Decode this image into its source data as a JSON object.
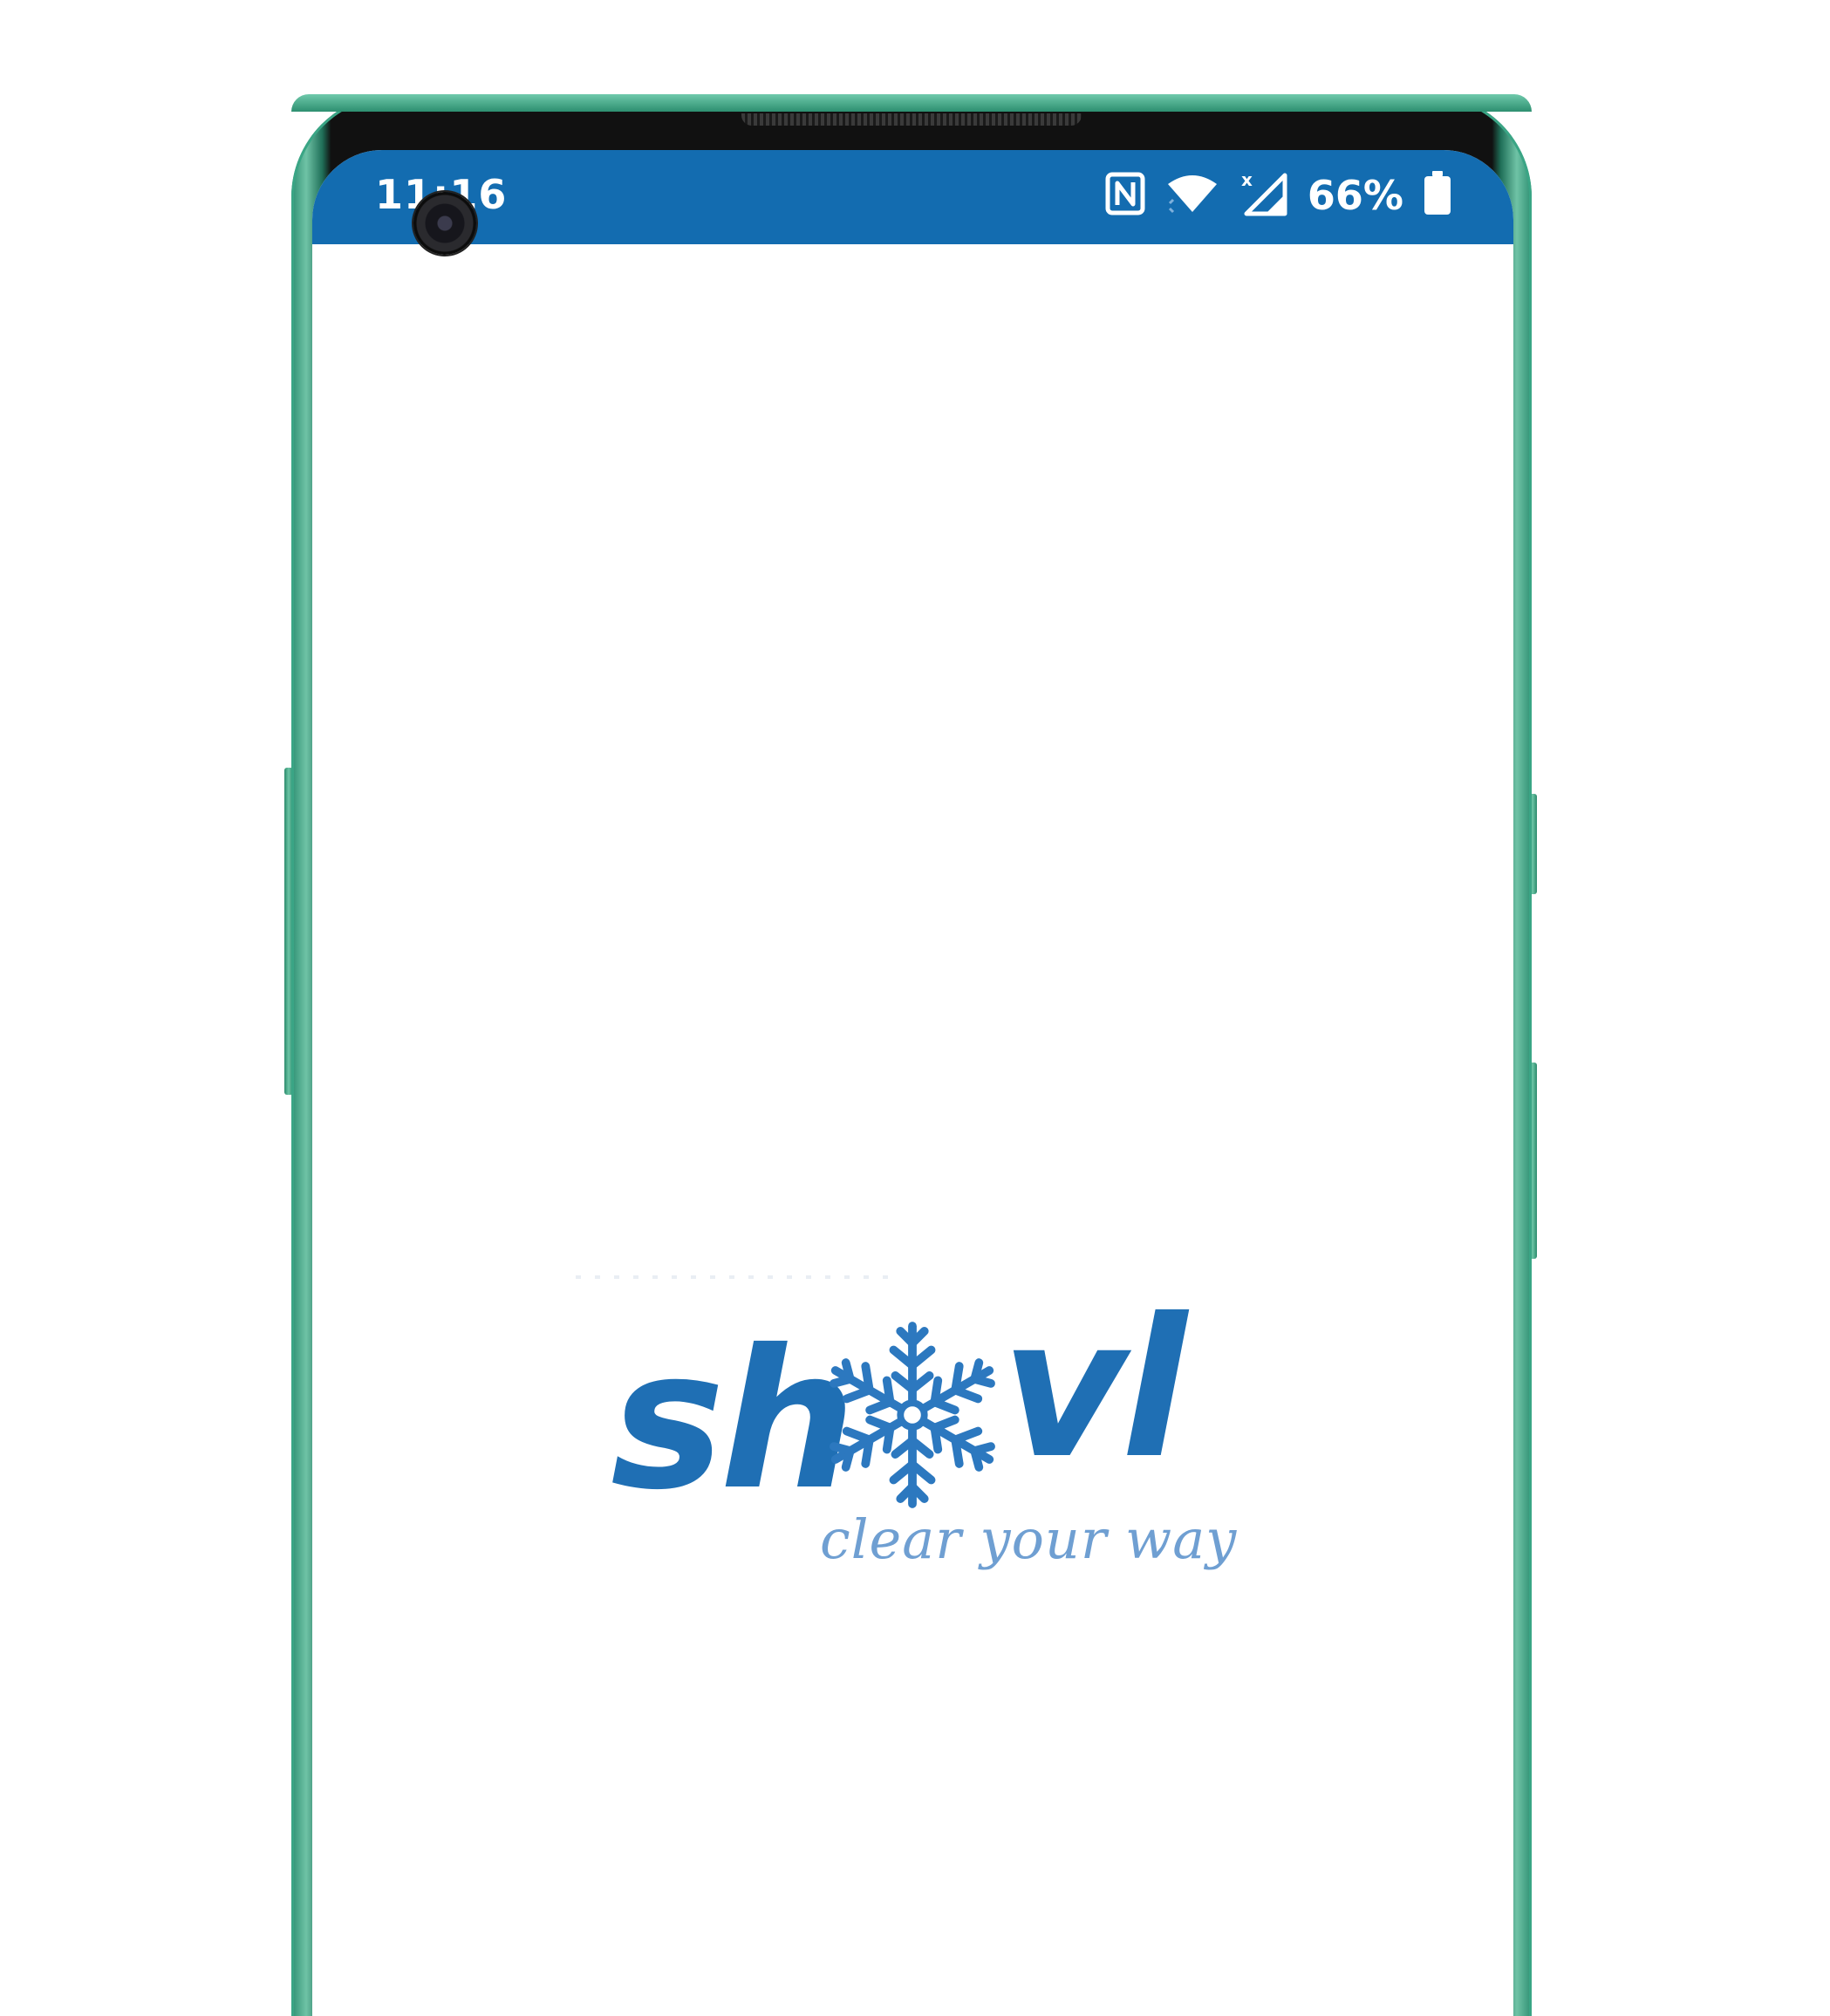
{
  "status_bar": {
    "time": "11:16",
    "battery_percent": "66%",
    "nfc_icon": "nfc-icon",
    "wifi_icon": "wifi-icon",
    "signal_icon": "cell-signal-no-service-icon",
    "battery_icon": "battery-icon",
    "color": "#136cb0"
  },
  "splash": {
    "logo_text_left": "sh",
    "logo_text_right": "vl",
    "logo_icon": "snowflake-icon",
    "tagline": "clear your way",
    "logo_color": "#1f6fb4",
    "tagline_color": "#6f9fd2"
  },
  "device": {
    "frame_color": "#2e8f72"
  }
}
